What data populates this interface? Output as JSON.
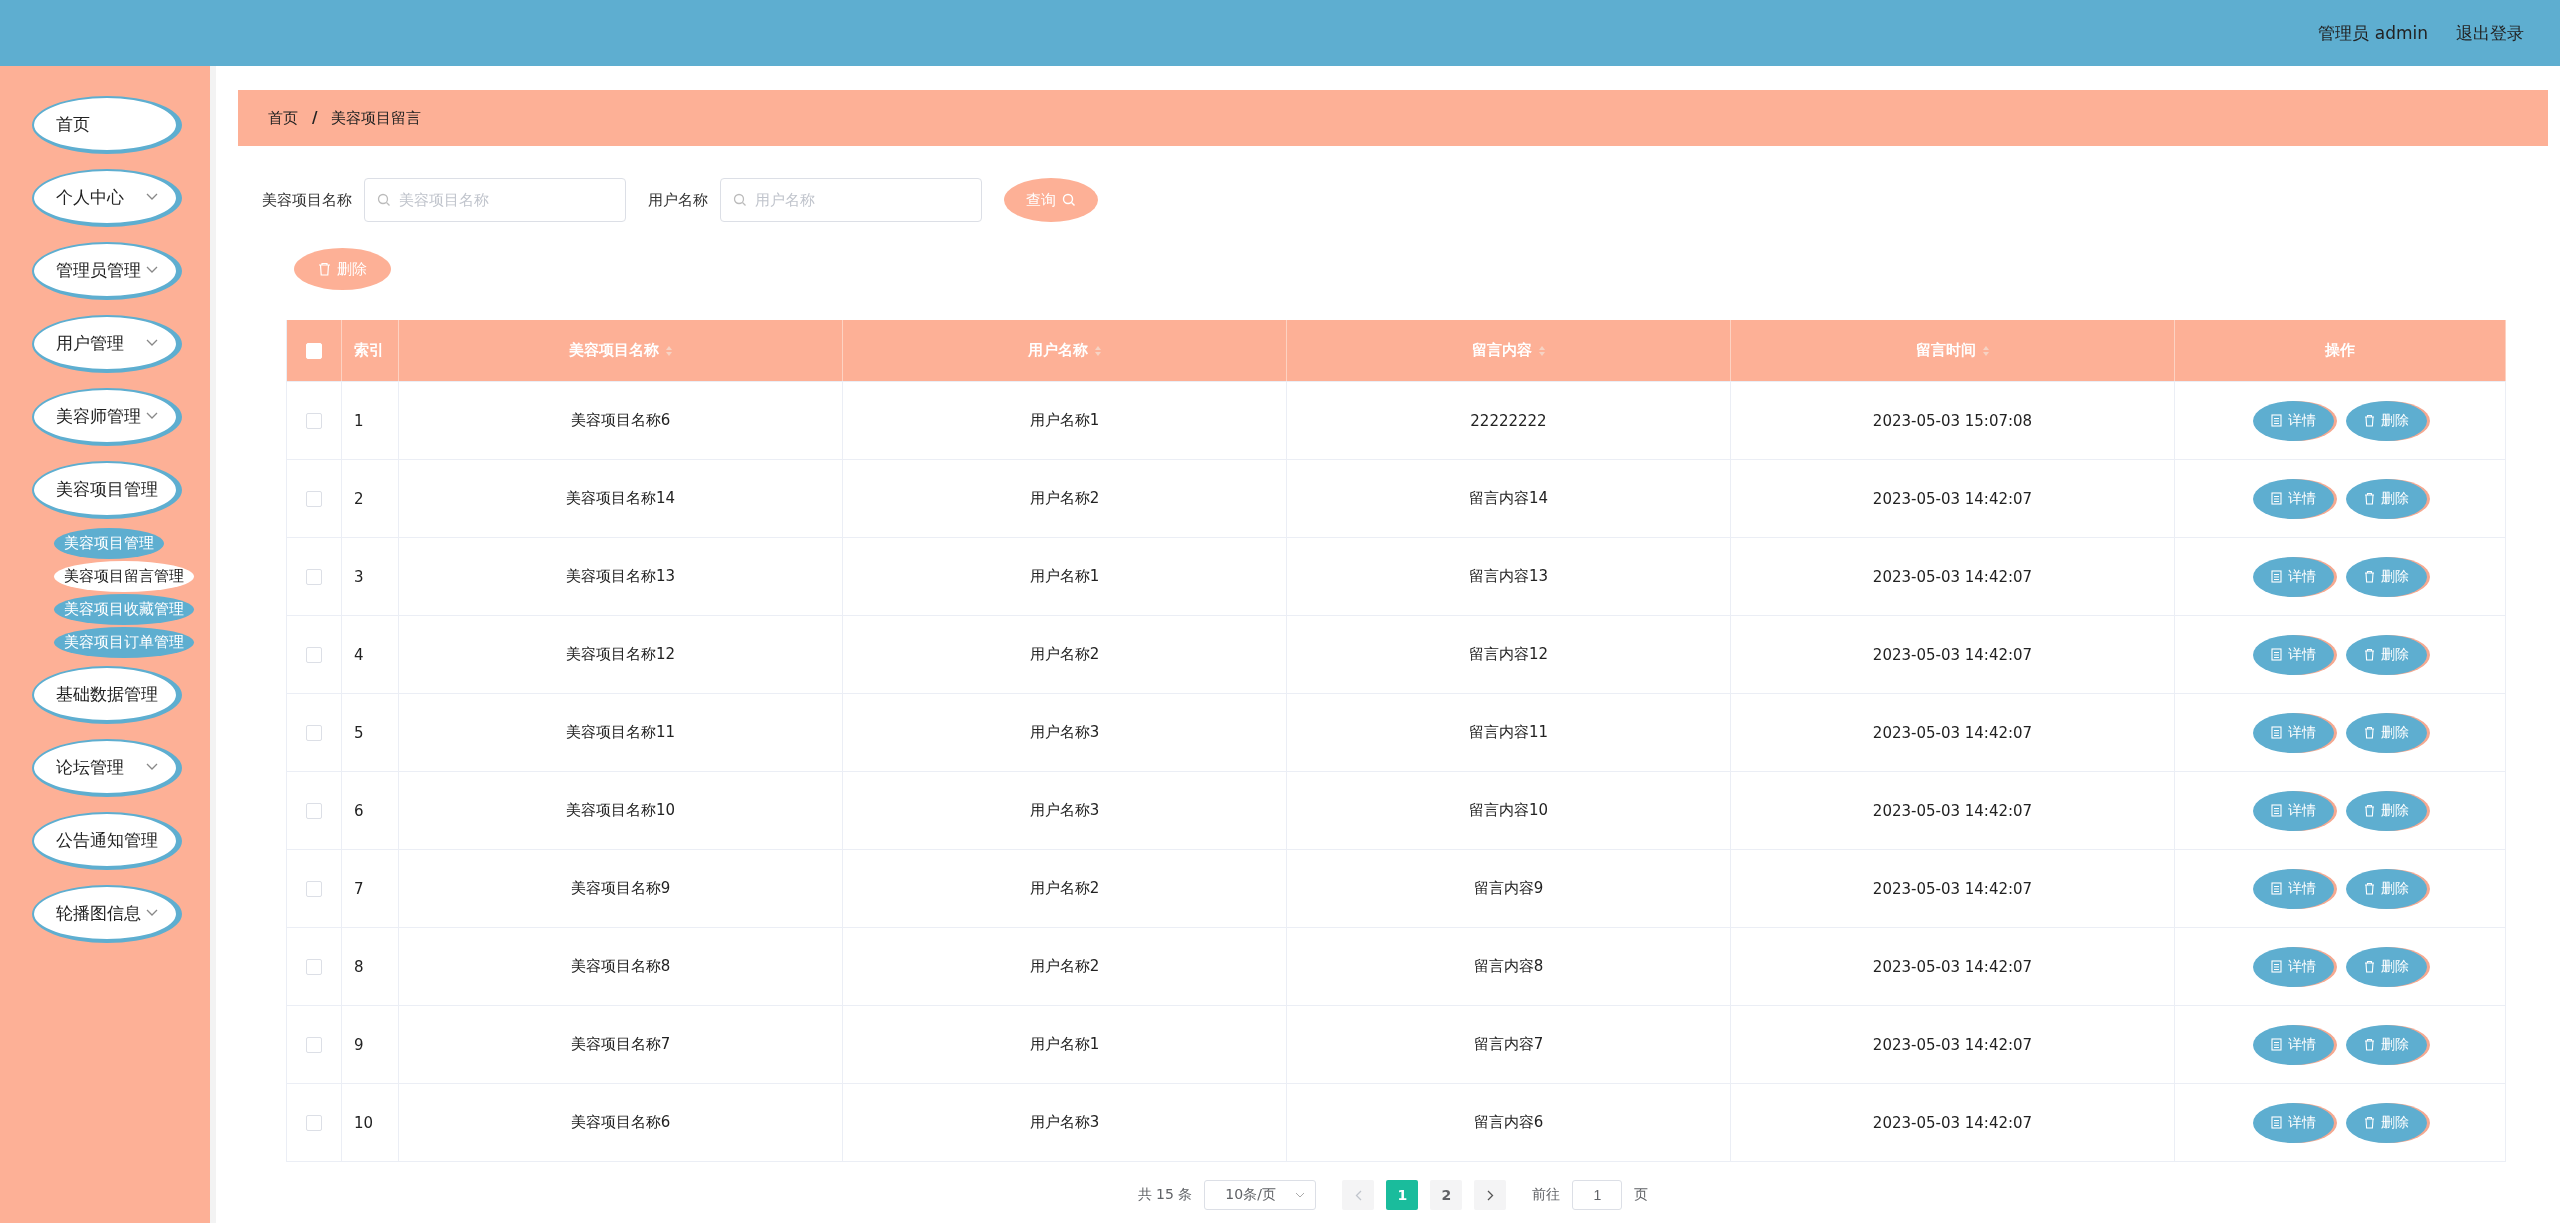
{
  "header": {
    "user": "管理员 admin",
    "logout": "退出登录"
  },
  "sidebar": {
    "items": [
      {
        "label": "首页",
        "expandable": false
      },
      {
        "label": "个人中心",
        "expandable": true
      },
      {
        "label": "管理员管理",
        "expandable": true
      },
      {
        "label": "用户管理",
        "expandable": true
      },
      {
        "label": "美容师管理",
        "expandable": true
      },
      {
        "label": "美容项目管理",
        "expandable": false,
        "children": [
          {
            "label": "美容项目管理",
            "selected": false
          },
          {
            "label": "美容项目留言管理",
            "selected": true
          },
          {
            "label": "美容项目收藏管理",
            "selected": false
          },
          {
            "label": "美容项目订单管理",
            "selected": false
          }
        ]
      },
      {
        "label": "基础数据管理",
        "expandable": false
      },
      {
        "label": "论坛管理",
        "expandable": true
      },
      {
        "label": "公告通知管理",
        "expandable": false
      },
      {
        "label": "轮播图信息",
        "expandable": true
      }
    ]
  },
  "breadcrumb": {
    "items": [
      "首页",
      "美容项目留言"
    ],
    "separator": "/"
  },
  "search": {
    "fields": [
      {
        "label": "美容项目名称",
        "placeholder": "美容项目名称"
      },
      {
        "label": "用户名称",
        "placeholder": "用户名称"
      }
    ],
    "button": "查询"
  },
  "delete_button": "删除",
  "table": {
    "columns": [
      {
        "label": "索引",
        "sortable": false
      },
      {
        "label": "美容项目名称",
        "sortable": true
      },
      {
        "label": "用户名称",
        "sortable": true
      },
      {
        "label": "留言内容",
        "sortable": true
      },
      {
        "label": "留言时间",
        "sortable": true
      },
      {
        "label": "操作",
        "sortable": false
      }
    ],
    "all_checked": false,
    "rows": [
      {
        "checked": false,
        "cells": [
          "1",
          "美容项目名称6",
          "用户名称1",
          "22222222",
          "2023-05-03 15:07:08"
        ],
        "actions": [
          "详情",
          "删除"
        ]
      },
      {
        "checked": false,
        "cells": [
          "2",
          "美容项目名称14",
          "用户名称2",
          "留言内容14",
          "2023-05-03 14:42:07"
        ],
        "actions": [
          "详情",
          "删除"
        ]
      },
      {
        "checked": false,
        "cells": [
          "3",
          "美容项目名称13",
          "用户名称1",
          "留言内容13",
          "2023-05-03 14:42:07"
        ],
        "actions": [
          "详情",
          "删除"
        ]
      },
      {
        "checked": false,
        "cells": [
          "4",
          "美容项目名称12",
          "用户名称2",
          "留言内容12",
          "2023-05-03 14:42:07"
        ],
        "actions": [
          "详情",
          "删除"
        ]
      },
      {
        "checked": false,
        "cells": [
          "5",
          "美容项目名称11",
          "用户名称3",
          "留言内容11",
          "2023-05-03 14:42:07"
        ],
        "actions": [
          "详情",
          "删除"
        ]
      },
      {
        "checked": false,
        "cells": [
          "6",
          "美容项目名称10",
          "用户名称3",
          "留言内容10",
          "2023-05-03 14:42:07"
        ],
        "actions": [
          "详情",
          "删除"
        ]
      },
      {
        "checked": false,
        "cells": [
          "7",
          "美容项目名称9",
          "用户名称2",
          "留言内容9",
          "2023-05-03 14:42:07"
        ],
        "actions": [
          "详情",
          "删除"
        ]
      },
      {
        "checked": false,
        "cells": [
          "8",
          "美容项目名称8",
          "用户名称2",
          "留言内容8",
          "2023-05-03 14:42:07"
        ],
        "actions": [
          "详情",
          "删除"
        ]
      },
      {
        "checked": false,
        "cells": [
          "9",
          "美容项目名称7",
          "用户名称1",
          "留言内容7",
          "2023-05-03 14:42:07"
        ],
        "actions": [
          "详情",
          "删除"
        ]
      },
      {
        "checked": false,
        "cells": [
          "10",
          "美容项目名称6",
          "用户名称3",
          "留言内容6",
          "2023-05-03 14:42:07"
        ],
        "actions": [
          "详情",
          "删除"
        ]
      }
    ]
  },
  "pagination": {
    "total": "共 15 条",
    "page_size": "10条/页",
    "pages": [
      {
        "label": "1",
        "selected": true
      },
      {
        "label": "2",
        "selected": false
      }
    ],
    "goto_label": "前往",
    "goto_value": "1",
    "goto_suffix": "页"
  }
}
